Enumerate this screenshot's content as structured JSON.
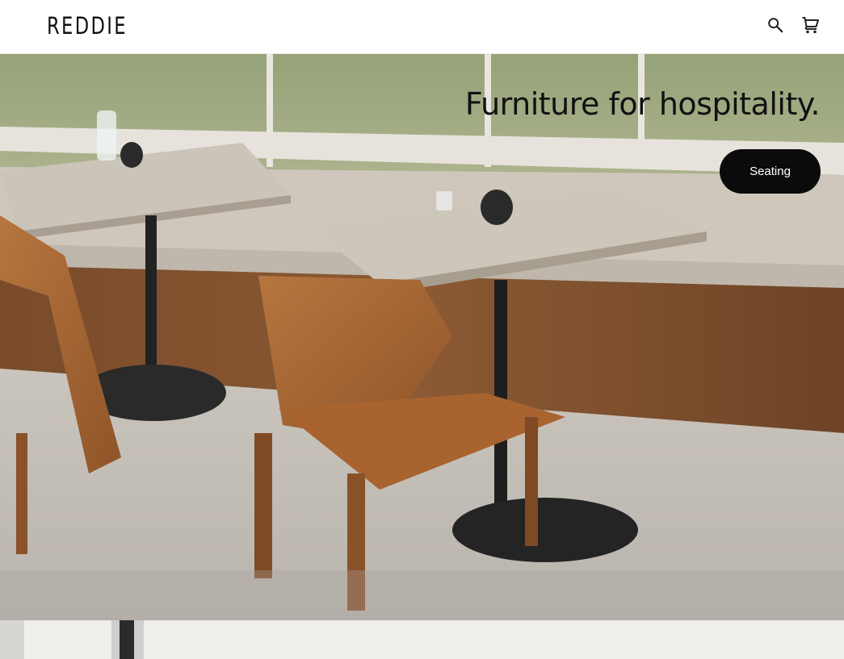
{
  "header": {
    "logo": "REDDIE",
    "search_icon": "search-icon",
    "cart_icon": "shopping-cart-icon"
  },
  "hero": {
    "title": "Furniture for hospitality.",
    "button_label": "Seating",
    "accent": "#0b0b0b"
  },
  "second_section": {
    "title": ""
  }
}
